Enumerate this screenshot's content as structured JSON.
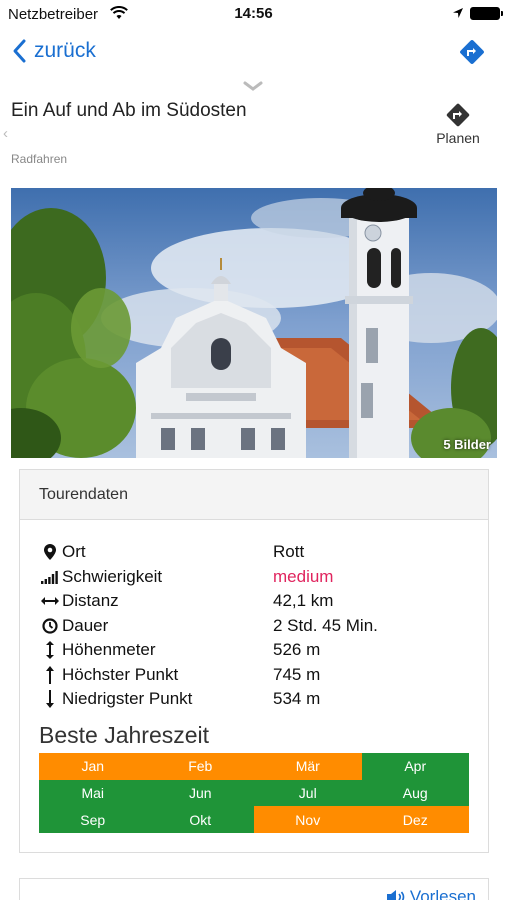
{
  "status_bar": {
    "carrier": "Netzbetreiber",
    "time": "14:56"
  },
  "nav": {
    "back_label": "zurück",
    "route_icon": "directions-icon"
  },
  "header": {
    "title": "Ein Auf und Ab im Südosten",
    "category": "Radfahren",
    "plan_label": "Planen",
    "plan_icon": "directions-icon"
  },
  "hero": {
    "image_count_label": "5 Bilder"
  },
  "tour_data": {
    "heading": "Tourendaten",
    "rows": [
      {
        "icon": "location-pin-icon",
        "label": "Ort",
        "value": "Rott"
      },
      {
        "icon": "signal-bars-icon",
        "label": "Schwierigkeit",
        "value": "medium"
      },
      {
        "icon": "distance-arrows-icon",
        "label": "Distanz",
        "value": "42,1 km"
      },
      {
        "icon": "clock-icon",
        "label": "Dauer",
        "value": "2 Std. 45 Min."
      },
      {
        "icon": "vertical-arrows-icon",
        "label": "Höhenmeter",
        "value": "526 m"
      },
      {
        "icon": "arrow-up-icon",
        "label": "Höchster Punkt",
        "value": "745 m"
      },
      {
        "icon": "arrow-down-icon",
        "label": "Niedrigster Punkt",
        "value": "534 m"
      }
    ],
    "difficulty_color": "#e0245e"
  },
  "season": {
    "title": "Beste Jahreszeit",
    "colors": {
      "recommended": "#1f9438",
      "possible": "#ff8c00"
    },
    "months": [
      {
        "label": "Jan",
        "status": "possible"
      },
      {
        "label": "Feb",
        "status": "possible"
      },
      {
        "label": "Mär",
        "status": "possible"
      },
      {
        "label": "Apr",
        "status": "recommended"
      },
      {
        "label": "Mai",
        "status": "recommended"
      },
      {
        "label": "Jun",
        "status": "recommended"
      },
      {
        "label": "Jul",
        "status": "recommended"
      },
      {
        "label": "Aug",
        "status": "recommended"
      },
      {
        "label": "Sep",
        "status": "recommended"
      },
      {
        "label": "Okt",
        "status": "recommended"
      },
      {
        "label": "Nov",
        "status": "possible"
      },
      {
        "label": "Dez",
        "status": "possible"
      }
    ]
  },
  "next_card": {
    "readout_label": "Vorlesen",
    "readout_icon": "speaker-icon"
  },
  "colors": {
    "accent_blue": "#1a6fd1"
  }
}
